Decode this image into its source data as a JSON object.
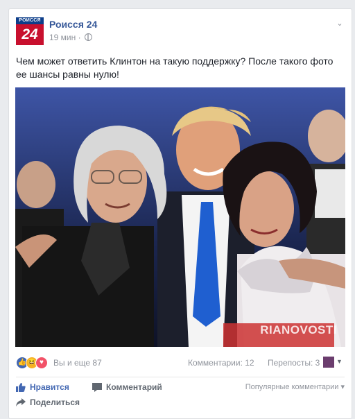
{
  "post": {
    "logo": {
      "top_text": "РОИССЯ",
      "number": "24"
    },
    "page_name": "Роисся 24",
    "time": "19 мин",
    "separator": "·",
    "text": "Чем может ответить Клинтон на такую поддержку? После такого фото ее шансы равны нулю!",
    "photo": {
      "watermark": "RIANOVOSTI"
    },
    "reactions": {
      "icons": [
        "like-icon",
        "haha-icon",
        "love-icon"
      ],
      "count_text": "Вы и еще 87",
      "comments_text": "Комментарии: 12",
      "shares_text": "Перепосты: 3"
    },
    "actions": {
      "like": "Нравится",
      "comment": "Комментарий",
      "share": "Поделиться",
      "sort": "Популярные комментарии ▾"
    }
  },
  "colors": {
    "link": "#365899",
    "like_blue": "#4267b2",
    "love_red": "#f25268",
    "haha_yellow": "#f7b125"
  }
}
